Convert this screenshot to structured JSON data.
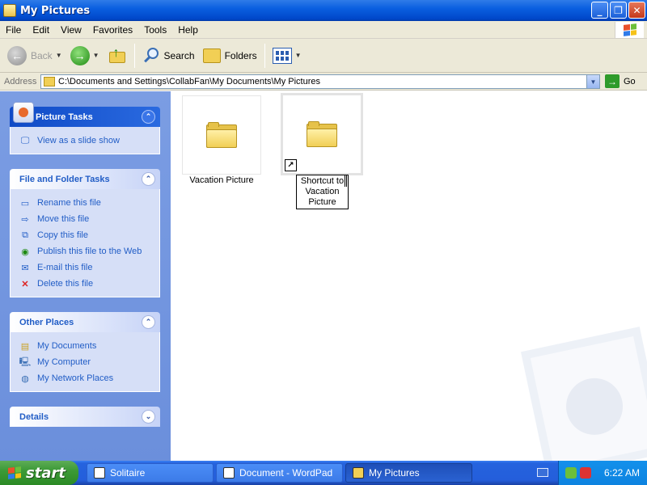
{
  "window": {
    "title": "My Pictures"
  },
  "menu": [
    "File",
    "Edit",
    "View",
    "Favorites",
    "Tools",
    "Help"
  ],
  "toolbar": {
    "back": "Back",
    "search": "Search",
    "folders": "Folders"
  },
  "address": {
    "label": "Address",
    "path": "C:\\Documents and Settings\\CollabFan\\My Documents\\My Pictures",
    "go": "Go"
  },
  "taskpane": {
    "picture_tasks": {
      "title": "Picture Tasks",
      "items": [
        "View as a slide show"
      ]
    },
    "file_tasks": {
      "title": "File and Folder Tasks",
      "items": [
        "Rename this file",
        "Move this file",
        "Copy this file",
        "Publish this file to the Web",
        "E-mail this file",
        "Delete this file"
      ]
    },
    "other_places": {
      "title": "Other Places",
      "items": [
        "My Documents",
        "My Computer",
        "My Network Places"
      ]
    },
    "details": {
      "title": "Details"
    }
  },
  "content": {
    "items": [
      {
        "label": "Vacation Picture"
      },
      {
        "label_line1": "Shortcut to",
        "label_line2": "Vacation",
        "label_line3": "Picture"
      }
    ]
  },
  "taskbar": {
    "start": "start",
    "buttons": [
      "Solitaire",
      "Document - WordPad",
      "My Pictures"
    ],
    "clock": "6:22 AM"
  },
  "colors": {
    "title_bar": "#0a5fe0",
    "taskpane_bg": "#7b9de3",
    "link": "#215dc6",
    "start_green": "#3c9a37"
  }
}
